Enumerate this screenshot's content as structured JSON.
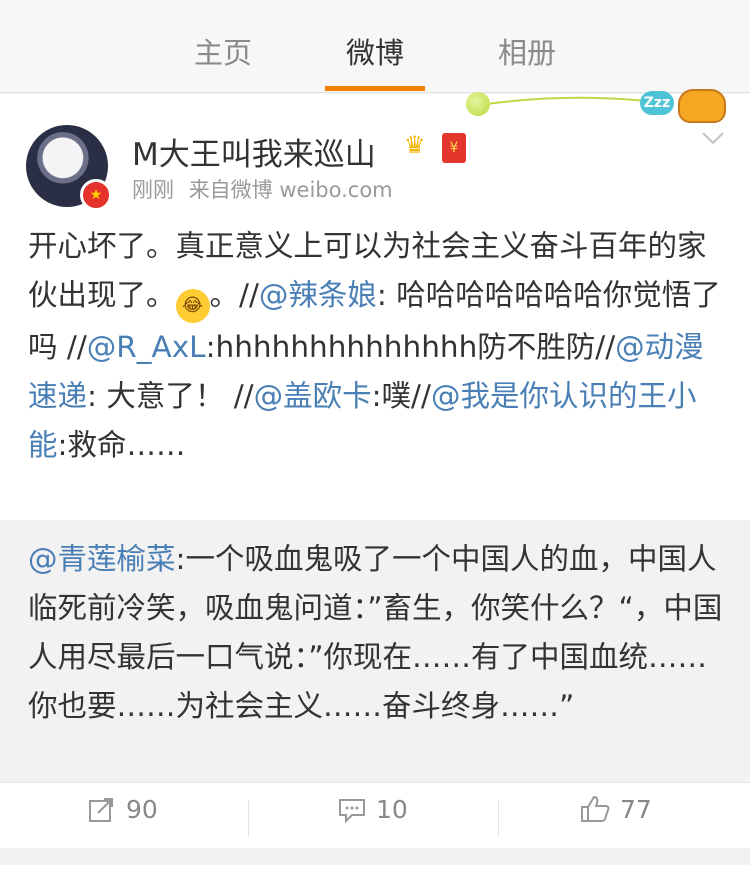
{
  "tabs": [
    {
      "label": "主页"
    },
    {
      "label": "微博"
    },
    {
      "label": "相册"
    }
  ],
  "active_tab": "微博",
  "decoration": {
    "zzz_label": "Zzz"
  },
  "post": {
    "username": "M大王叫我来巡山",
    "time": "刚刚",
    "source": "来自微博 weibo.com",
    "body": [
      {
        "t": "开心坏了。真正意义上可以为社会主义奋斗百年的家伙出现了。"
      },
      {
        "emoji": "laugh"
      },
      {
        "t": "。//"
      },
      {
        "m": "@辣条娘"
      },
      {
        "t": ": 哈哈哈哈哈哈哈你觉悟了吗 //"
      },
      {
        "m": "@R_AxL"
      },
      {
        "t": ":hhhhhhhhhhhhhh防不胜防//"
      },
      {
        "m": "@动漫速递"
      },
      {
        "t": ": 大意了！ //"
      },
      {
        "m": "@盖欧卡"
      },
      {
        "t": ":噗//"
      },
      {
        "m": "@我是你认识的王小能"
      },
      {
        "t": ":救命……"
      }
    ]
  },
  "quoted": {
    "author": "@青莲榆菜",
    "text": ":一个吸血鬼吸了一个中国人的血，中国人临死前冷笑，吸血鬼问道：”畜生，你笑什么？“，中国人用尽最后一口气说：”你现在……有了中国血统……你也要……为社会主义……奋斗终身……”"
  },
  "actions": {
    "repost_count": "90",
    "comment_count": "10",
    "like_count": "77"
  },
  "colors": {
    "accent": "#f28100",
    "mention": "#4a7fb5",
    "badge_red": "#e4332a"
  },
  "icons": [
    "chevron-down-icon",
    "repost-icon",
    "comment-icon",
    "like-icon",
    "crown-icon",
    "red-packet-icon"
  ]
}
